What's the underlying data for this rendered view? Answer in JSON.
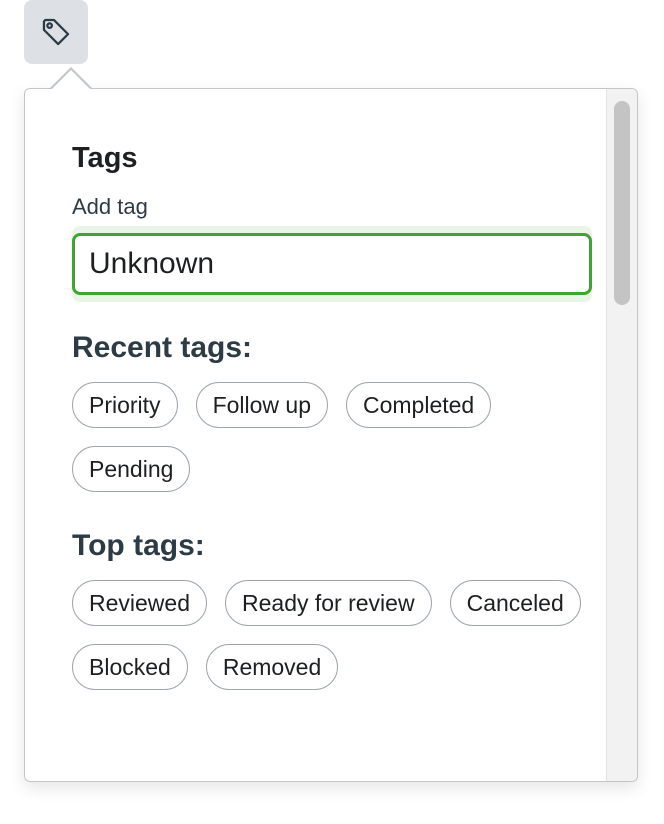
{
  "trigger": {
    "icon": "tag-icon"
  },
  "popover": {
    "title": "Tags",
    "add_tag_label": "Add tag",
    "add_tag_value": "Unknown",
    "recent_heading": "Recent tags:",
    "recent_tags": [
      "Priority",
      "Follow up",
      "Completed",
      "Pending"
    ],
    "top_heading": "Top tags:",
    "top_tags": [
      "Reviewed",
      "Ready for review",
      "Canceled",
      "Blocked",
      "Removed"
    ]
  },
  "colors": {
    "focus_border": "#3ea531",
    "focus_glow": "#e9f5e6",
    "trigger_bg": "#dde1e5",
    "chip_border": "#9ea6ad"
  }
}
